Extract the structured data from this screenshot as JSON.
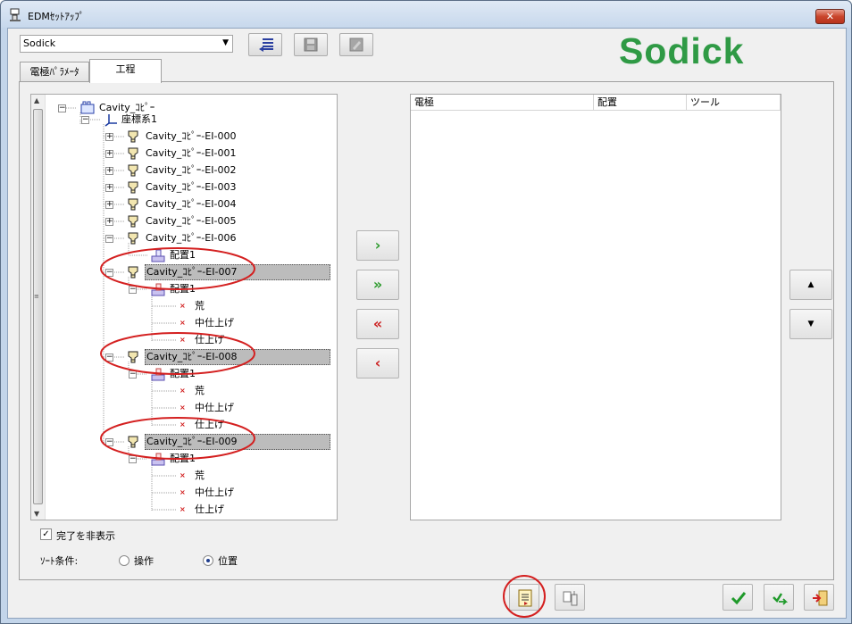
{
  "window": {
    "title": "EDMｾｯﾄｱｯﾌﾟ",
    "close_label": "✕"
  },
  "toolbar": {
    "combo_value": "Sodick"
  },
  "logo": {
    "text": "Sodick"
  },
  "tabs": [
    {
      "label": "電極ﾊﾟﾗﾒｰﾀ",
      "active": false
    },
    {
      "label": "工程",
      "active": true
    }
  ],
  "tree": {
    "root": "Cavity_ｺﾋﾟｰ",
    "csys": "座標系1",
    "electrodes": [
      "Cavity_ｺﾋﾟｰ-EI-000",
      "Cavity_ｺﾋﾟｰ-EI-001",
      "Cavity_ｺﾋﾟｰ-EI-002",
      "Cavity_ｺﾋﾟｰ-EI-003",
      "Cavity_ｺﾋﾟｰ-EI-004",
      "Cavity_ｺﾋﾟｰ-EI-005",
      "Cavity_ｺﾋﾟｰ-EI-006"
    ],
    "el006_child": "配置1",
    "groups": [
      {
        "name": "Cavity_ｺﾋﾟｰ-EI-007",
        "placement": "配置1",
        "ops": [
          "荒",
          "中仕上げ",
          "仕上げ"
        ]
      },
      {
        "name": "Cavity_ｺﾋﾟｰ-EI-008",
        "placement": "配置1",
        "ops": [
          "荒",
          "中仕上げ",
          "仕上げ"
        ]
      },
      {
        "name": "Cavity_ｺﾋﾟｰ-EI-009",
        "placement": "配置1",
        "ops": [
          "荒",
          "中仕上げ",
          "仕上げ"
        ]
      }
    ]
  },
  "transfer_buttons": {
    "add": "›",
    "add_all": "»",
    "remove_all": "«",
    "remove": "‹"
  },
  "list": {
    "columns": [
      "電極",
      "配置",
      "ツール"
    ]
  },
  "order_buttons": {
    "up": "▲",
    "down": "▼"
  },
  "options": {
    "hide_done_label": "完了を非表示",
    "hide_done_checked": true,
    "sort_label": "ｿｰﾄ条件:",
    "sort_options": [
      "操作",
      "位置"
    ],
    "sort_selected": "位置"
  },
  "colors": {
    "logo": "#2f9a45",
    "annotation": "#d42020",
    "accent_green": "#2d9b2d",
    "accent_red": "#cc2020"
  }
}
